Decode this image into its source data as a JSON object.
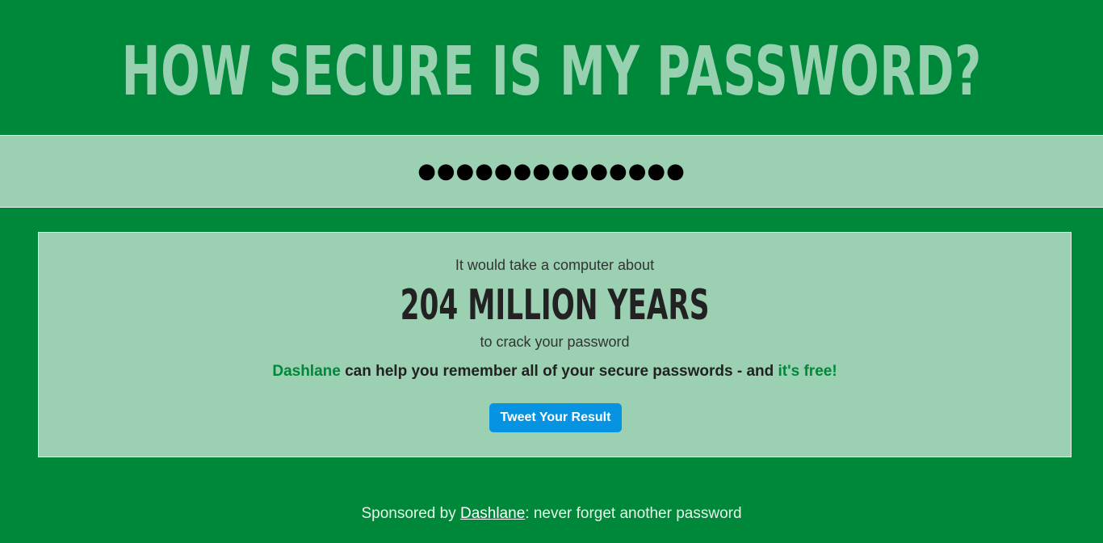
{
  "header": {
    "title": "HOW SECURE IS MY PASSWORD?"
  },
  "password_field": {
    "value": "●●●●●●●●●●●●●●"
  },
  "result": {
    "intro": "It would take a computer about",
    "time": "204 MILLION YEARS",
    "outro": "to crack your password",
    "promo": {
      "brand": "Dashlane",
      "middle": " can help you remember all of your secure passwords - and ",
      "free": "it's free!"
    },
    "tweet_button": "Tweet Your Result"
  },
  "footer": {
    "prefix": "Sponsored by ",
    "link": "Dashlane",
    "suffix": ": never forget another password"
  },
  "colors": {
    "background": "#00883a",
    "panel": "#9bd1b2",
    "title": "#98d1b0",
    "tweet_button": "#0593e2"
  }
}
